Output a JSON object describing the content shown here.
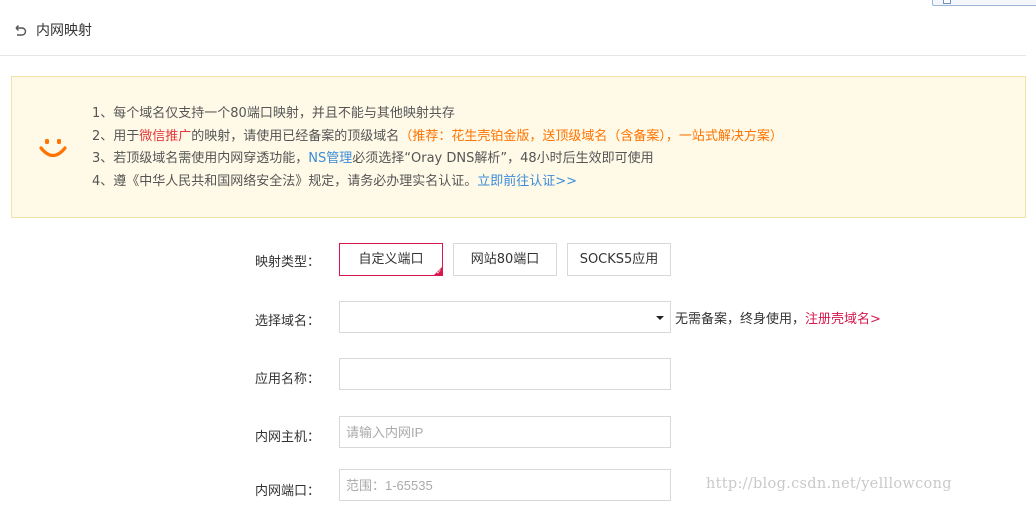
{
  "header": {
    "title": "内网映射",
    "back_icon": "undo-arrow-icon"
  },
  "notice": {
    "icon": "smile-icon",
    "accent_color": "#ff7300",
    "line1": {
      "text": "1、每个域名仅支持一个80端口映射，并且不能与其他映射共存"
    },
    "line2": {
      "prefix": "2、用于",
      "highlight": "微信推广",
      "middle": "的映射，请使用已经备案的顶级域名",
      "recommend": "（推荐：花生壳铂金版，送顶级域名（含备案），一站式解决方案）"
    },
    "line3": {
      "prefix": "3、若顶级域名需使用内网穿透功能，",
      "ns": "NS管理",
      "suffix": "必须选择“Oray DNS解析”，48小时后生效即可使用"
    },
    "line4": {
      "prefix": "4、遵《中华人民共和国网络安全法》规定，请务必办理实名认证。",
      "link": "立即前往认证>>"
    }
  },
  "form": {
    "type_label": "映射类型：",
    "type_options": [
      "自定义端口",
      "网站80端口",
      "SOCKS5应用"
    ],
    "type_selected": "自定义端口",
    "domain_label": "选择域名：",
    "domain_value": "",
    "domain_hint": "无需备案，终身使用，",
    "domain_link": "注册壳域名>",
    "app_name_label": "应用名称：",
    "app_name_value": "",
    "host_label": "内网主机：",
    "host_placeholder": "请输入内网IP",
    "port_label": "内网端口：",
    "port_placeholder": "范围：1-65535"
  },
  "watermark": "http://blog.csdn.net/yelllowcong",
  "colors": {
    "active_border": "#d6184e",
    "link_blue": "#3b8cd9",
    "notice_bg": "#fffae8"
  }
}
